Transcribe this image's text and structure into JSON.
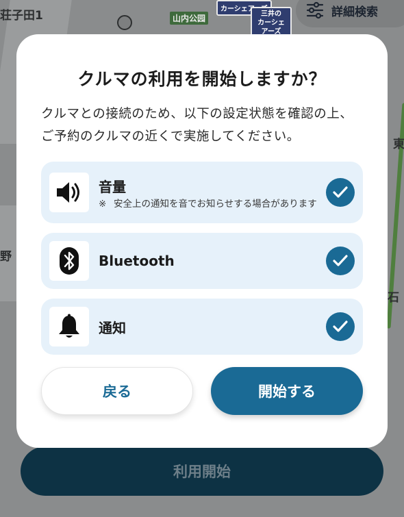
{
  "map": {
    "labels": {
      "top_left": "荘子田1",
      "park": "山内公园",
      "left_mid": "野",
      "right_mid": "石",
      "right_top": "東",
      "sign1": "カーシェアーズ",
      "sign2_top": "三井の",
      "sign2_bottom": "カーシェアーズ"
    },
    "filter_label": "詳細検索"
  },
  "background_button": {
    "label": "利用開始"
  },
  "modal": {
    "title": "クルマの利用を開始しますか？",
    "description": "クルマとの接続のため、以下の設定状態を確認の上、ご予約のクルマの近くで実施してください。",
    "permissions": [
      {
        "label": "音量",
        "note_mark": "※",
        "note": "安全上の通知を音でお知らせする場合があります",
        "icon": "speaker-icon",
        "checked": true
      },
      {
        "label": "Bluetooth",
        "icon": "bluetooth-icon",
        "checked": true
      },
      {
        "label": "通知",
        "icon": "bell-icon",
        "checked": true
      }
    ],
    "buttons": {
      "back": "戻る",
      "start": "開始する"
    }
  },
  "colors": {
    "accent": "#1a6a95",
    "item_bg": "#e6f1fa",
    "overlay": "#7d7f80",
    "bottom_bar": "#0d3244"
  }
}
